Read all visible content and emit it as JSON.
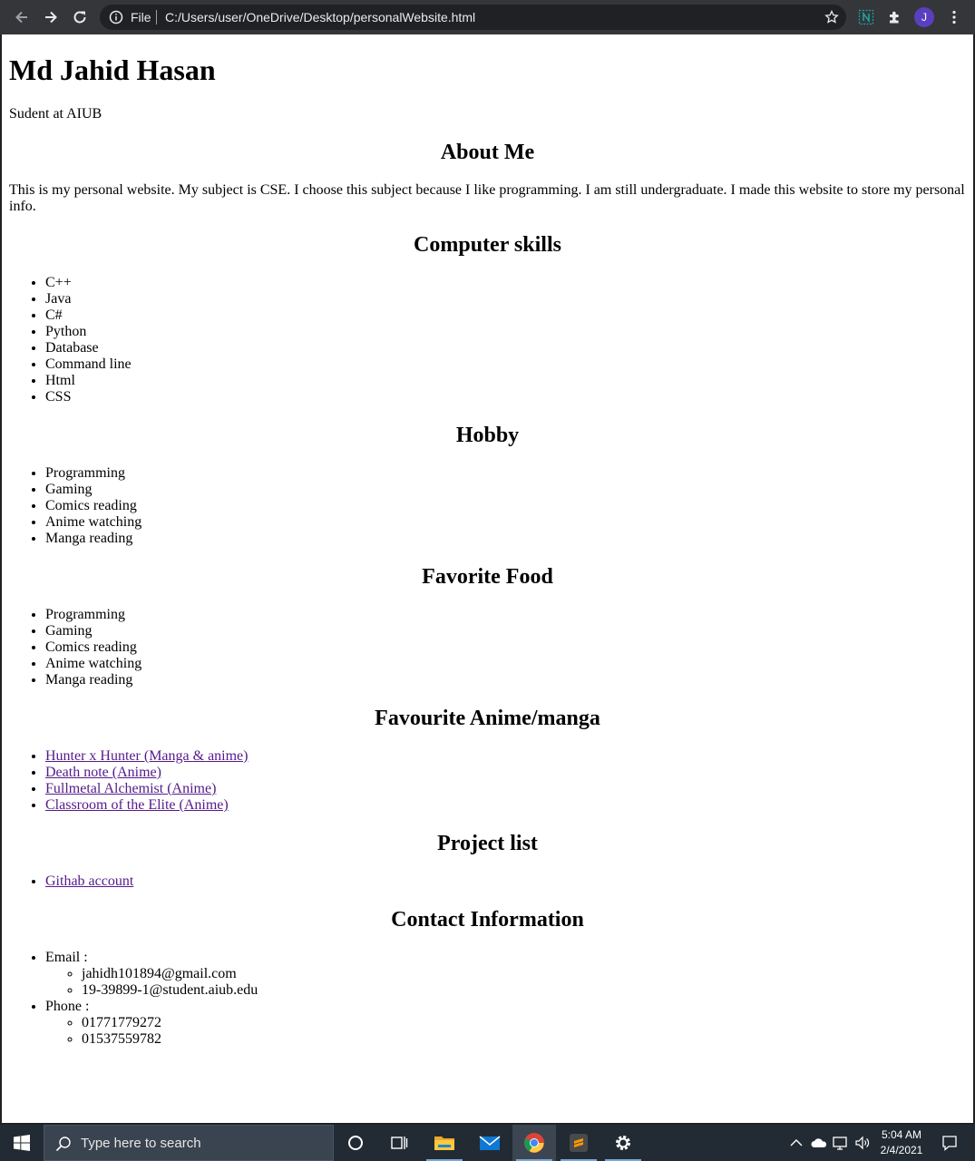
{
  "browser": {
    "omnibox_scheme": "File",
    "url": "C:/Users/user/OneDrive/Desktop/personalWebsite.html",
    "profile_initial": "J"
  },
  "page": {
    "name": "Md Jahid Hasan",
    "tagline": "Sudent at AIUB",
    "about": {
      "heading": "About Me",
      "text": "This is my personal website. My subject is CSE. I choose this subject because I like programming. I am still undergraduate. I made this website to store my personal info."
    },
    "skills": {
      "heading": "Computer skills",
      "items": [
        "C++",
        "Java",
        "C#",
        "Python",
        "Database",
        "Command line",
        "Html",
        "CSS"
      ]
    },
    "hobby": {
      "heading": "Hobby",
      "items": [
        "Programming",
        "Gaming",
        "Comics reading",
        "Anime watching",
        "Manga reading"
      ]
    },
    "food": {
      "heading": "Favorite Food",
      "items": [
        "Programming",
        "Gaming",
        "Comics reading",
        "Anime watching",
        "Manga reading"
      ]
    },
    "anime": {
      "heading": "Favourite Anime/manga",
      "items": [
        "Hunter x Hunter (Manga & anime)",
        "Death note (Anime)",
        "Fullmetal Alchemist (Anime)",
        "Classroom of the Elite (Anime)"
      ]
    },
    "projects": {
      "heading": "Project list",
      "items": [
        "Githab account"
      ]
    },
    "contact": {
      "heading": "Contact Information",
      "email_label": "Email :",
      "emails": [
        "jahidh101894@gmail.com",
        "19-39899-1@student.aiub.edu"
      ],
      "phone_label": "Phone :",
      "phones": [
        "01771779272",
        "01537559782"
      ]
    }
  },
  "taskbar": {
    "search_placeholder": "Type here to search",
    "time": "5:04 AM",
    "date": "2/4/2021"
  },
  "colors": {
    "link_visited": "#551a8b",
    "toolbar_bg": "#35363a",
    "taskbar_bg": "#222b34",
    "avatar_bg": "#5a3fc0"
  }
}
